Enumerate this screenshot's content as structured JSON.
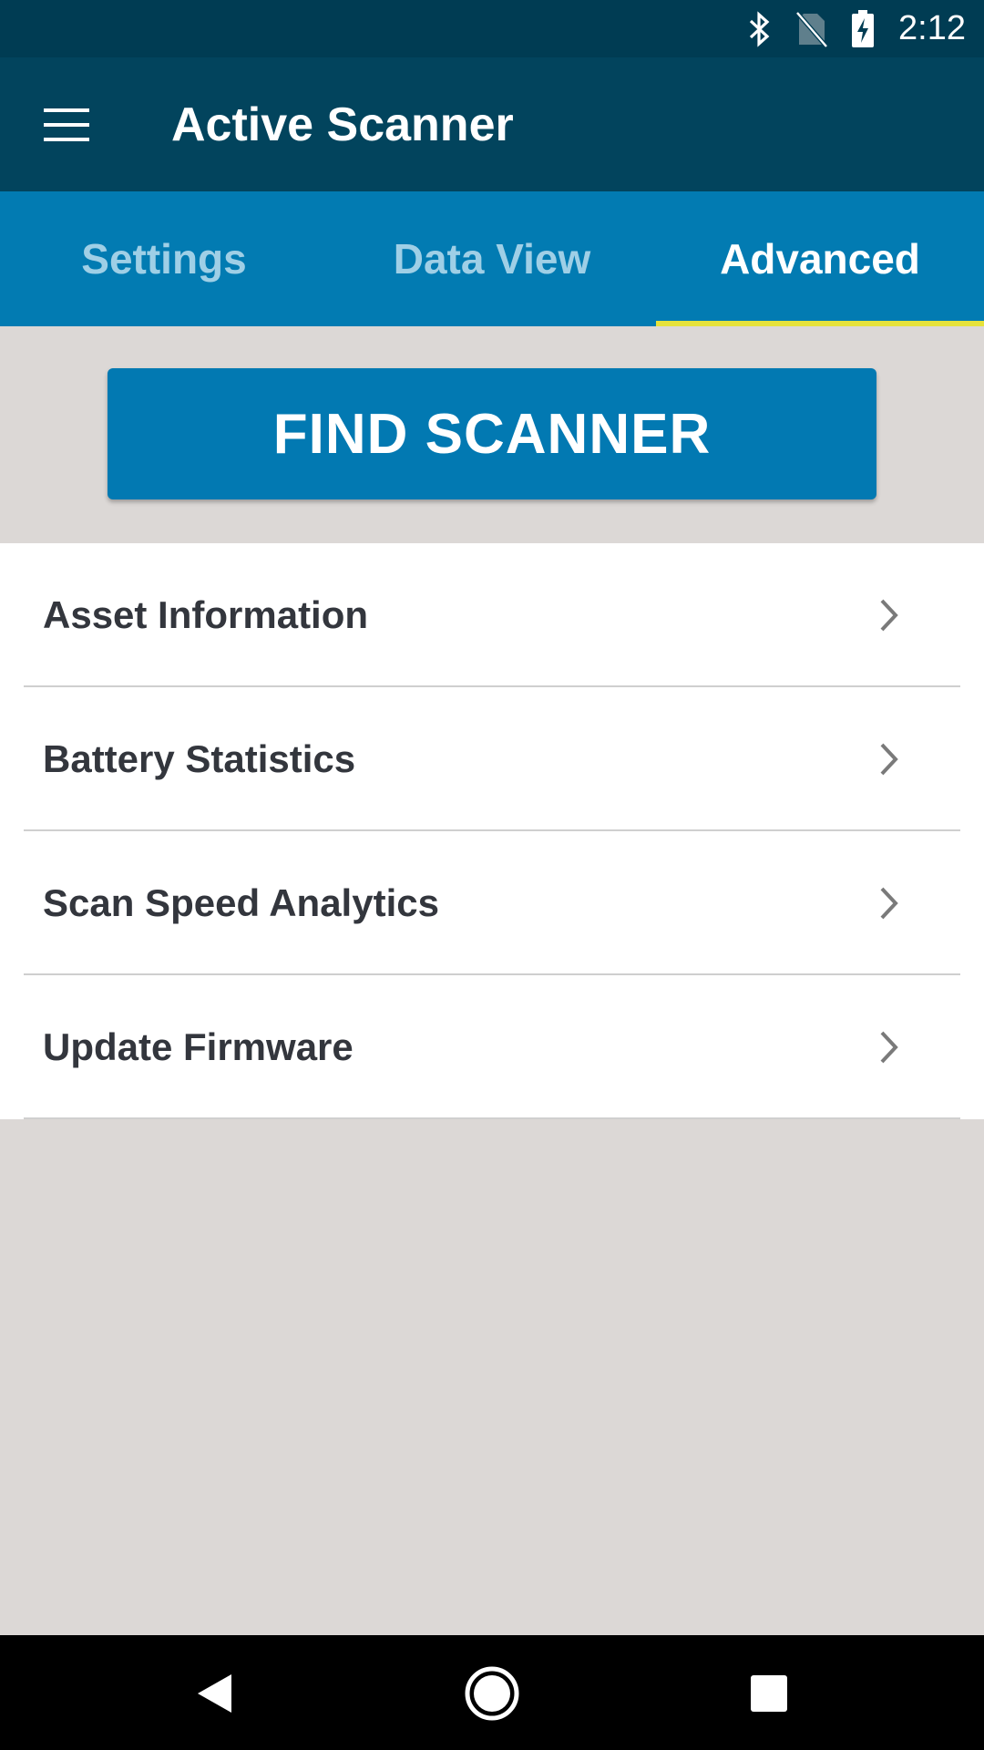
{
  "status_bar": {
    "time": "2:12",
    "icons": [
      "bluetooth-icon",
      "no-sim-icon",
      "battery-charging-icon"
    ]
  },
  "app_bar": {
    "title": "Active Scanner",
    "menu_icon": "hamburger-menu-icon"
  },
  "tabs": [
    {
      "label": "Settings",
      "active": false
    },
    {
      "label": "Data View",
      "active": false
    },
    {
      "label": "Advanced",
      "active": true
    }
  ],
  "find_button": {
    "label": "FIND SCANNER"
  },
  "menu_items": [
    {
      "label": "Asset Information",
      "icon": "chevron-right-icon"
    },
    {
      "label": "Battery Statistics",
      "icon": "chevron-right-icon"
    },
    {
      "label": "Scan Speed Analytics",
      "icon": "chevron-right-icon"
    },
    {
      "label": "Update Firmware",
      "icon": "chevron-right-icon"
    }
  ],
  "nav_bar": {
    "buttons": [
      "back-icon",
      "home-icon",
      "recents-icon"
    ]
  },
  "colors": {
    "status_bar": "#003c53",
    "app_bar": "#02445d",
    "tab_bar": "#027bb2",
    "tab_indicator": "#e6e23b",
    "button": "#0279b2",
    "background": "#dcd8d6"
  }
}
